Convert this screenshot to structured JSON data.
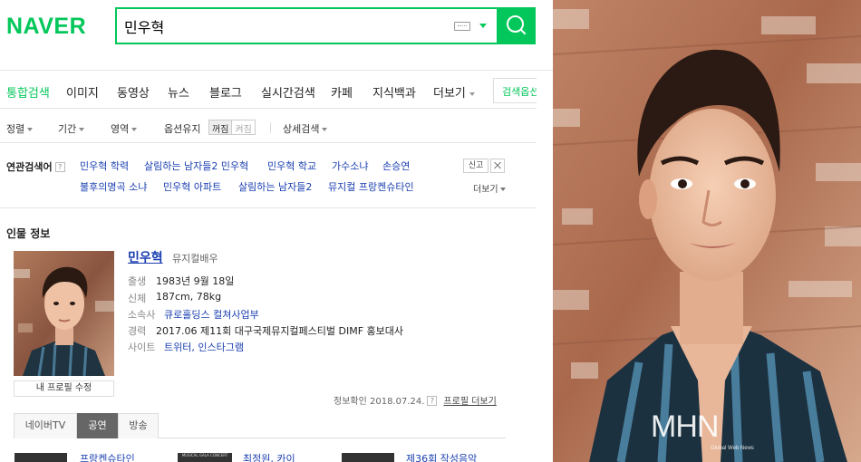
{
  "header": {
    "logo": "NAVER",
    "search_value": "민우혁"
  },
  "tabs": [
    {
      "label": "통합검색",
      "active": true
    },
    {
      "label": "이미지"
    },
    {
      "label": "동영상"
    },
    {
      "label": "뉴스"
    },
    {
      "label": "블로그"
    },
    {
      "label": "실시간검색"
    },
    {
      "label": "카페"
    },
    {
      "label": "지식백과"
    },
    {
      "label": "더보기"
    }
  ],
  "search_options_label": "검색옵션",
  "filters": {
    "sort": "정렬",
    "period": "기간",
    "area": "영역",
    "keep_options": "옵션유지",
    "on": "꺼짐",
    "off": "켜짐",
    "detail": "상세검색"
  },
  "related": {
    "title": "연관검색어",
    "help": "?",
    "row1": [
      "민우혁 학력",
      "살림하는 남자들2 민우혁",
      "민우혁 학교",
      "가수소냐",
      "손승연"
    ],
    "row2": [
      "불후의명곡 소냐",
      "민우혁 아파트",
      "살림하는 남자들2",
      "뮤지컬 프랑켄슈타인"
    ],
    "report": "신고",
    "more": "더보기"
  },
  "person": {
    "section_title": "인물 정보",
    "name": "민우혁",
    "job": "뮤지컬배우",
    "birth_key": "출생",
    "birth": "1983년 9월 18일",
    "body_key": "신체",
    "body": "187cm, 78kg",
    "agency_key": "소속사",
    "agency": "큐로홀딩스 컬쳐사업부",
    "career_key": "경력",
    "career": "2017.06 제11회 대구국제뮤지컬페스티벌 DIMF 홍보대사",
    "site_key": "사이트",
    "site": "트위터, 인스타그램",
    "edit_profile": "내 프로필 수정",
    "confirm": "정보확인 2018.07.24.",
    "confirm_help": "?",
    "profile_more": "프로필 더보기"
  },
  "subtabs": [
    {
      "label": "네이버TV"
    },
    {
      "label": "공연",
      "active": true
    },
    {
      "label": "방송"
    }
  ],
  "bottom_items": [
    "프랑켄슈타인",
    "최정원, 카이",
    "제36회 작성음악"
  ],
  "bottom_thumb_caption": "MUSICAL GALA CONCERT",
  "photo": {
    "watermark": "MHN",
    "watermark_sub": "Global Web News"
  },
  "colors": {
    "brand_green": "#03c75a",
    "link_blue": "#1a3fb0"
  }
}
